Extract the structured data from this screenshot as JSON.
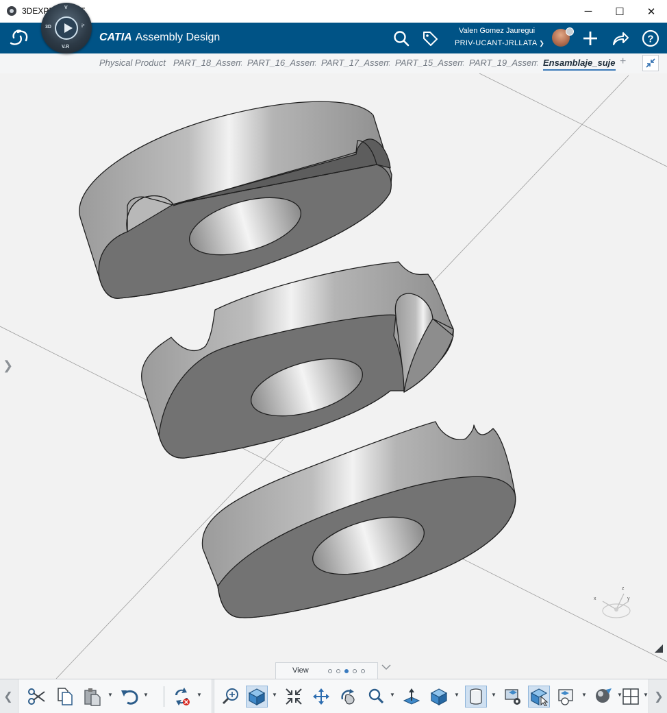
{
  "window": {
    "title": "3DEXPERIENCE",
    "minimize": "─",
    "maximize": "☐",
    "close": "✕"
  },
  "topbar": {
    "app_brand": "CATIA",
    "app_name": "Assembly Design",
    "compass": {
      "top": "V",
      "left": "3D",
      "right": "i³",
      "bottom": "V.R"
    },
    "user_name": "Valen Gomez Jauregui",
    "tenant": "PRIV-UCANT-JRLLATA",
    "icons": [
      "search-icon",
      "tag-icon",
      "plus-icon",
      "share-icon",
      "help-icon"
    ],
    "accent_color": "#005386"
  },
  "tabs": [
    {
      "label": "Physical Product",
      "active": false
    },
    {
      "label": "PART_18_Assem",
      "active": false
    },
    {
      "label": "PART_16_Assem",
      "active": false
    },
    {
      "label": "PART_17_Assem",
      "active": false
    },
    {
      "label": "PART_15_Assem",
      "active": false
    },
    {
      "label": "PART_19_Assem",
      "active": false
    },
    {
      "label": "Ensamblaje_suje",
      "active": true
    }
  ],
  "tab_add": "+",
  "viewport": {
    "background": "#f2f2f2",
    "content": "three-ring-assembly",
    "axis": {
      "x": "x",
      "y": "y",
      "z": "z"
    }
  },
  "view_panel": {
    "label": "View",
    "pages": 5,
    "active_page": 3
  },
  "action_bar": {
    "edit_tools": [
      "cut-icon",
      "copy-icon",
      "paste-icon",
      "undo-icon",
      "update-icon"
    ],
    "view_tools": [
      "fit-all-icon",
      "view-cube-icon",
      "zoom-icon",
      "pan-icon",
      "rotate-icon",
      "zoom-area-icon",
      "normal-view-icon",
      "iso-view-icon",
      "shading-icon",
      "hide-show-icon",
      "display-icon",
      "clipping-icon",
      "render-icon",
      "multi-view-icon"
    ]
  }
}
